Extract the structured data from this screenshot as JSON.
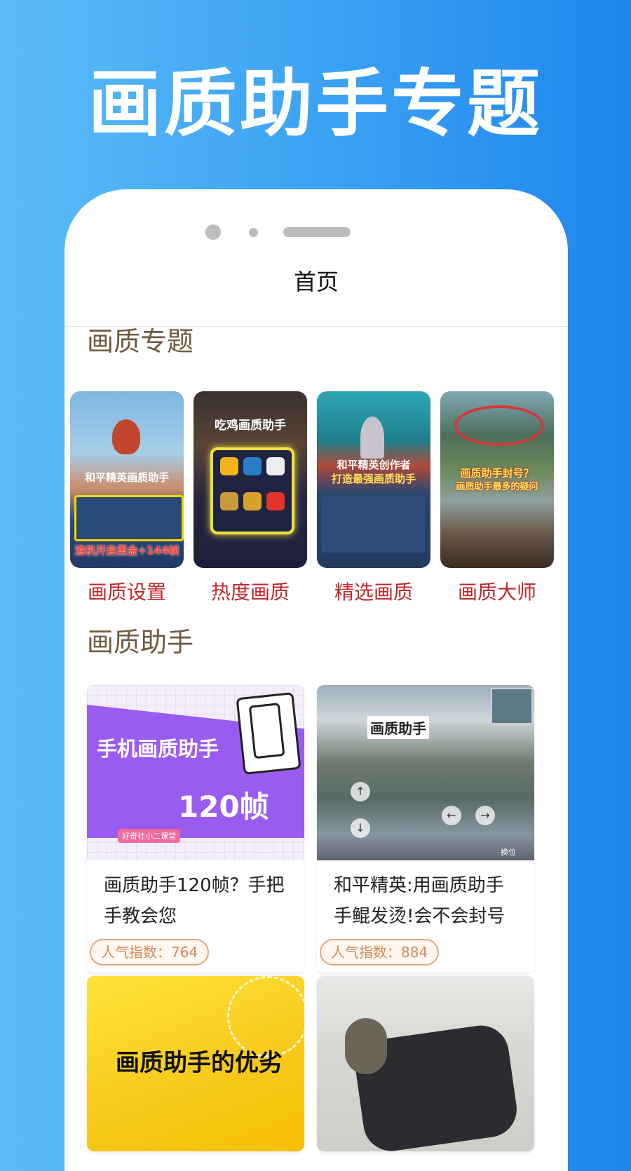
{
  "promo": {
    "title": "画质助手专题"
  },
  "nav": {
    "title": "首页"
  },
  "topics": {
    "heading": "画质专题",
    "items": [
      {
        "label": "画质设置",
        "thumb_caption": "和平精英画质助手",
        "thumb_banner": "渣机开启黑金+144帧"
      },
      {
        "label": "热度画质",
        "thumb_caption": "吃鸡画质助手"
      },
      {
        "label": "精选画质",
        "thumb_caption": "和平精英创作者",
        "thumb_banner": "打造最强画质助手"
      },
      {
        "label": "画质大师",
        "thumb_caption": "画质助手封号？",
        "thumb_banner": "画质助手最多的疑问"
      }
    ]
  },
  "helpers": {
    "heading": "画质助手",
    "items": [
      {
        "title": "画质助手120帧？手把手教会您",
        "popularity": "人气指数：764",
        "thumb_main": "手机画质助手",
        "thumb_fps": "120帧",
        "thumb_tag": "好奇社小二课堂"
      },
      {
        "title": "和平精英:用画质助手手鲲发烫!会不会封号",
        "popularity": "人气指数：884",
        "thumb_main": "画质助手",
        "thumb_tag": "换位"
      },
      {
        "thumb_main": "画质助手的优劣"
      },
      {}
    ]
  },
  "colors": {
    "background": "#3aa0f2",
    "section_heading": "#6f5b3e",
    "topic_label": "#c1272d",
    "badge": "#d48a55"
  }
}
